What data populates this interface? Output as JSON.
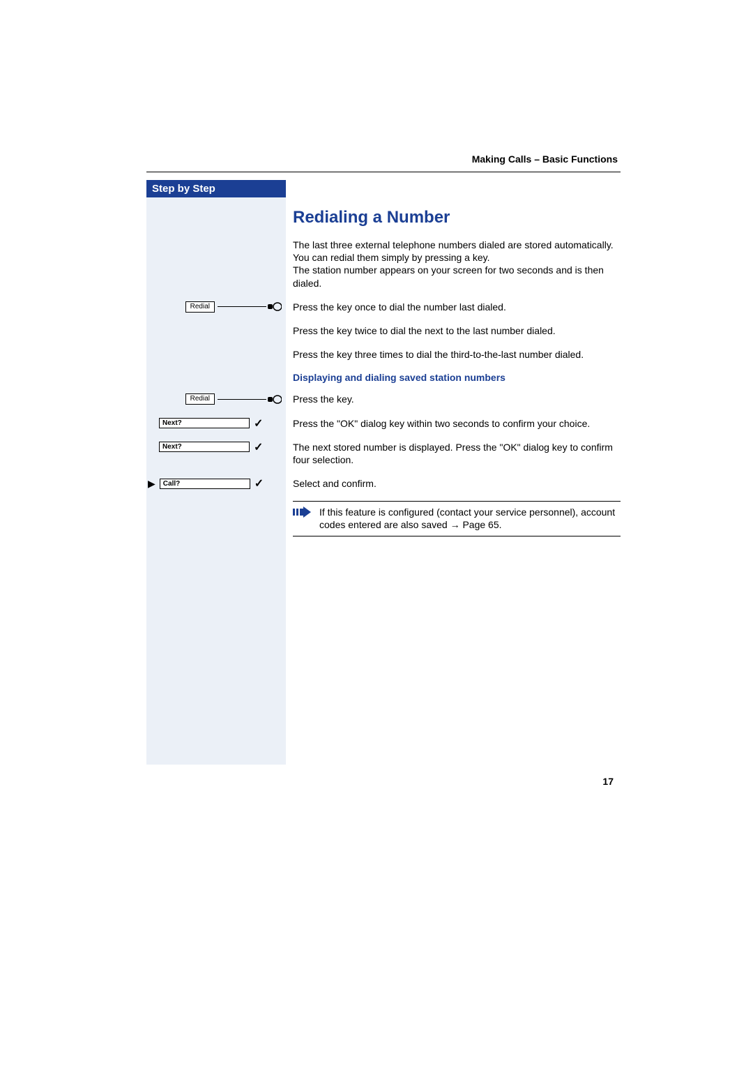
{
  "header": {
    "section": "Making Calls – Basic Functions"
  },
  "sidebar": {
    "title": "Step by Step",
    "widgets": {
      "redial1": "Redial",
      "redial2": "Redial",
      "next1": "Next?",
      "next2": "Next?",
      "call": "Call?"
    }
  },
  "main": {
    "h1": "Redialing a Number",
    "intro": "The last three external telephone numbers dialed are stored automatically.\nYou can redial them simply by pressing a key.\nThe station number appears on your screen for two seconds and is then dialed.",
    "press_once": "Press the key once to dial the number last dialed.",
    "press_twice": "Press the key twice to dial the next to the last number dialed.",
    "press_three": "Press the key three times to dial the third-to-the-last number dialed.",
    "subhead": "Displaying and dialing saved station numbers",
    "press_key": "Press the key.",
    "press_ok": "Press the \"OK\" dialog key within two seconds to confirm your choice.",
    "next_stored": "The next stored number is displayed. Press the \"OK\" dialog key to confirm four selection.",
    "select_confirm": "Select and confirm.",
    "note": "If this feature is configured (contact your service personnel), account codes entered are also saved → Page 65."
  },
  "page_number": "17"
}
